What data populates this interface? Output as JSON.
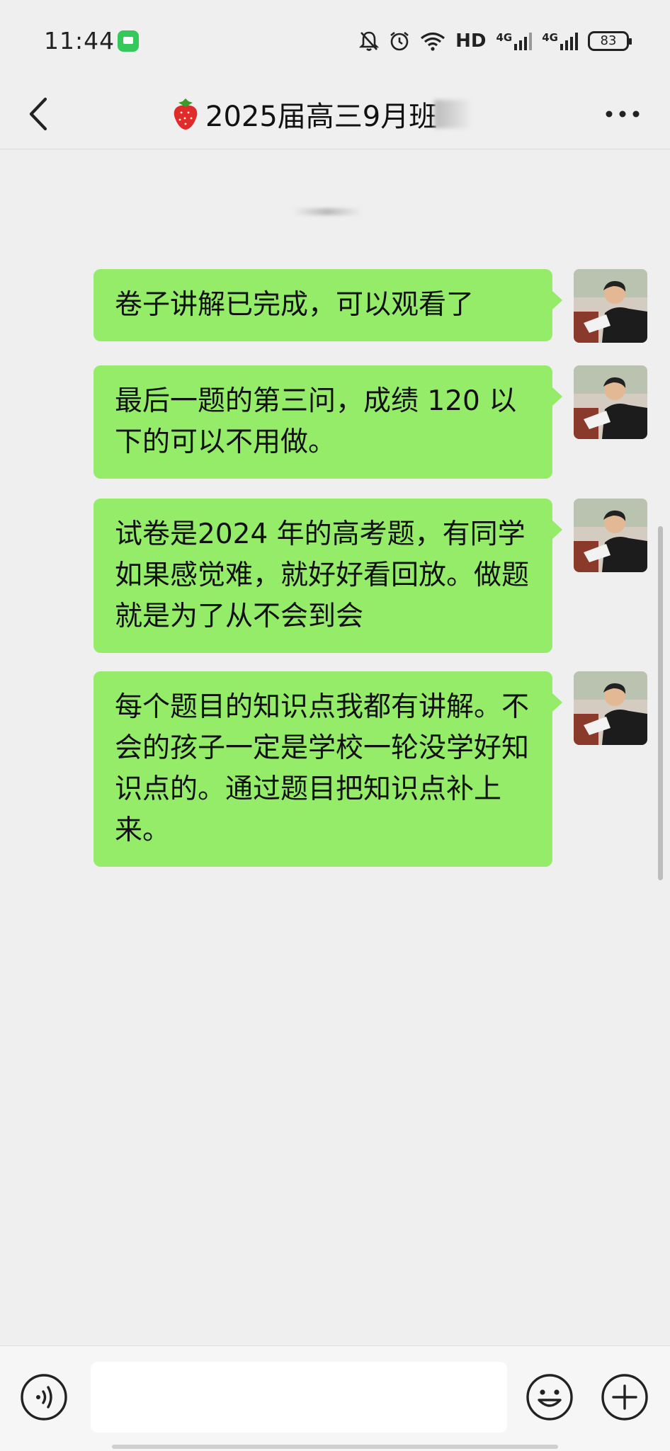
{
  "status_bar": {
    "time": "11:44",
    "hd_label": "HD",
    "network_1": "4G",
    "network_2": "4G",
    "battery": "83"
  },
  "header": {
    "title": "2025届高三9月班"
  },
  "messages": [
    {
      "text": "卷子讲解已完成，可以观看了"
    },
    {
      "text": "最后一题的第三问，成绩 120 以下的可以不用做。"
    },
    {
      "text": "试卷是2024 年的高考题，有同学如果感觉难，就好好看回放。做题就是为了从不会到会"
    },
    {
      "text": "每个题目的知识点我都有讲解。不会的孩子一定是学校一轮没学好知识点的。通过题目把知识点补上来。"
    }
  ],
  "colors": {
    "bubble": "#95ec69",
    "background": "#efefef",
    "badge": "#35c85b"
  },
  "icons": [
    "back-arrow-icon",
    "strawberry-icon",
    "more-icon",
    "voice-icon",
    "emoji-icon",
    "plus-icon",
    "wifi-icon",
    "alarm-icon",
    "mute-bell-icon",
    "signal-icon",
    "battery-icon"
  ]
}
